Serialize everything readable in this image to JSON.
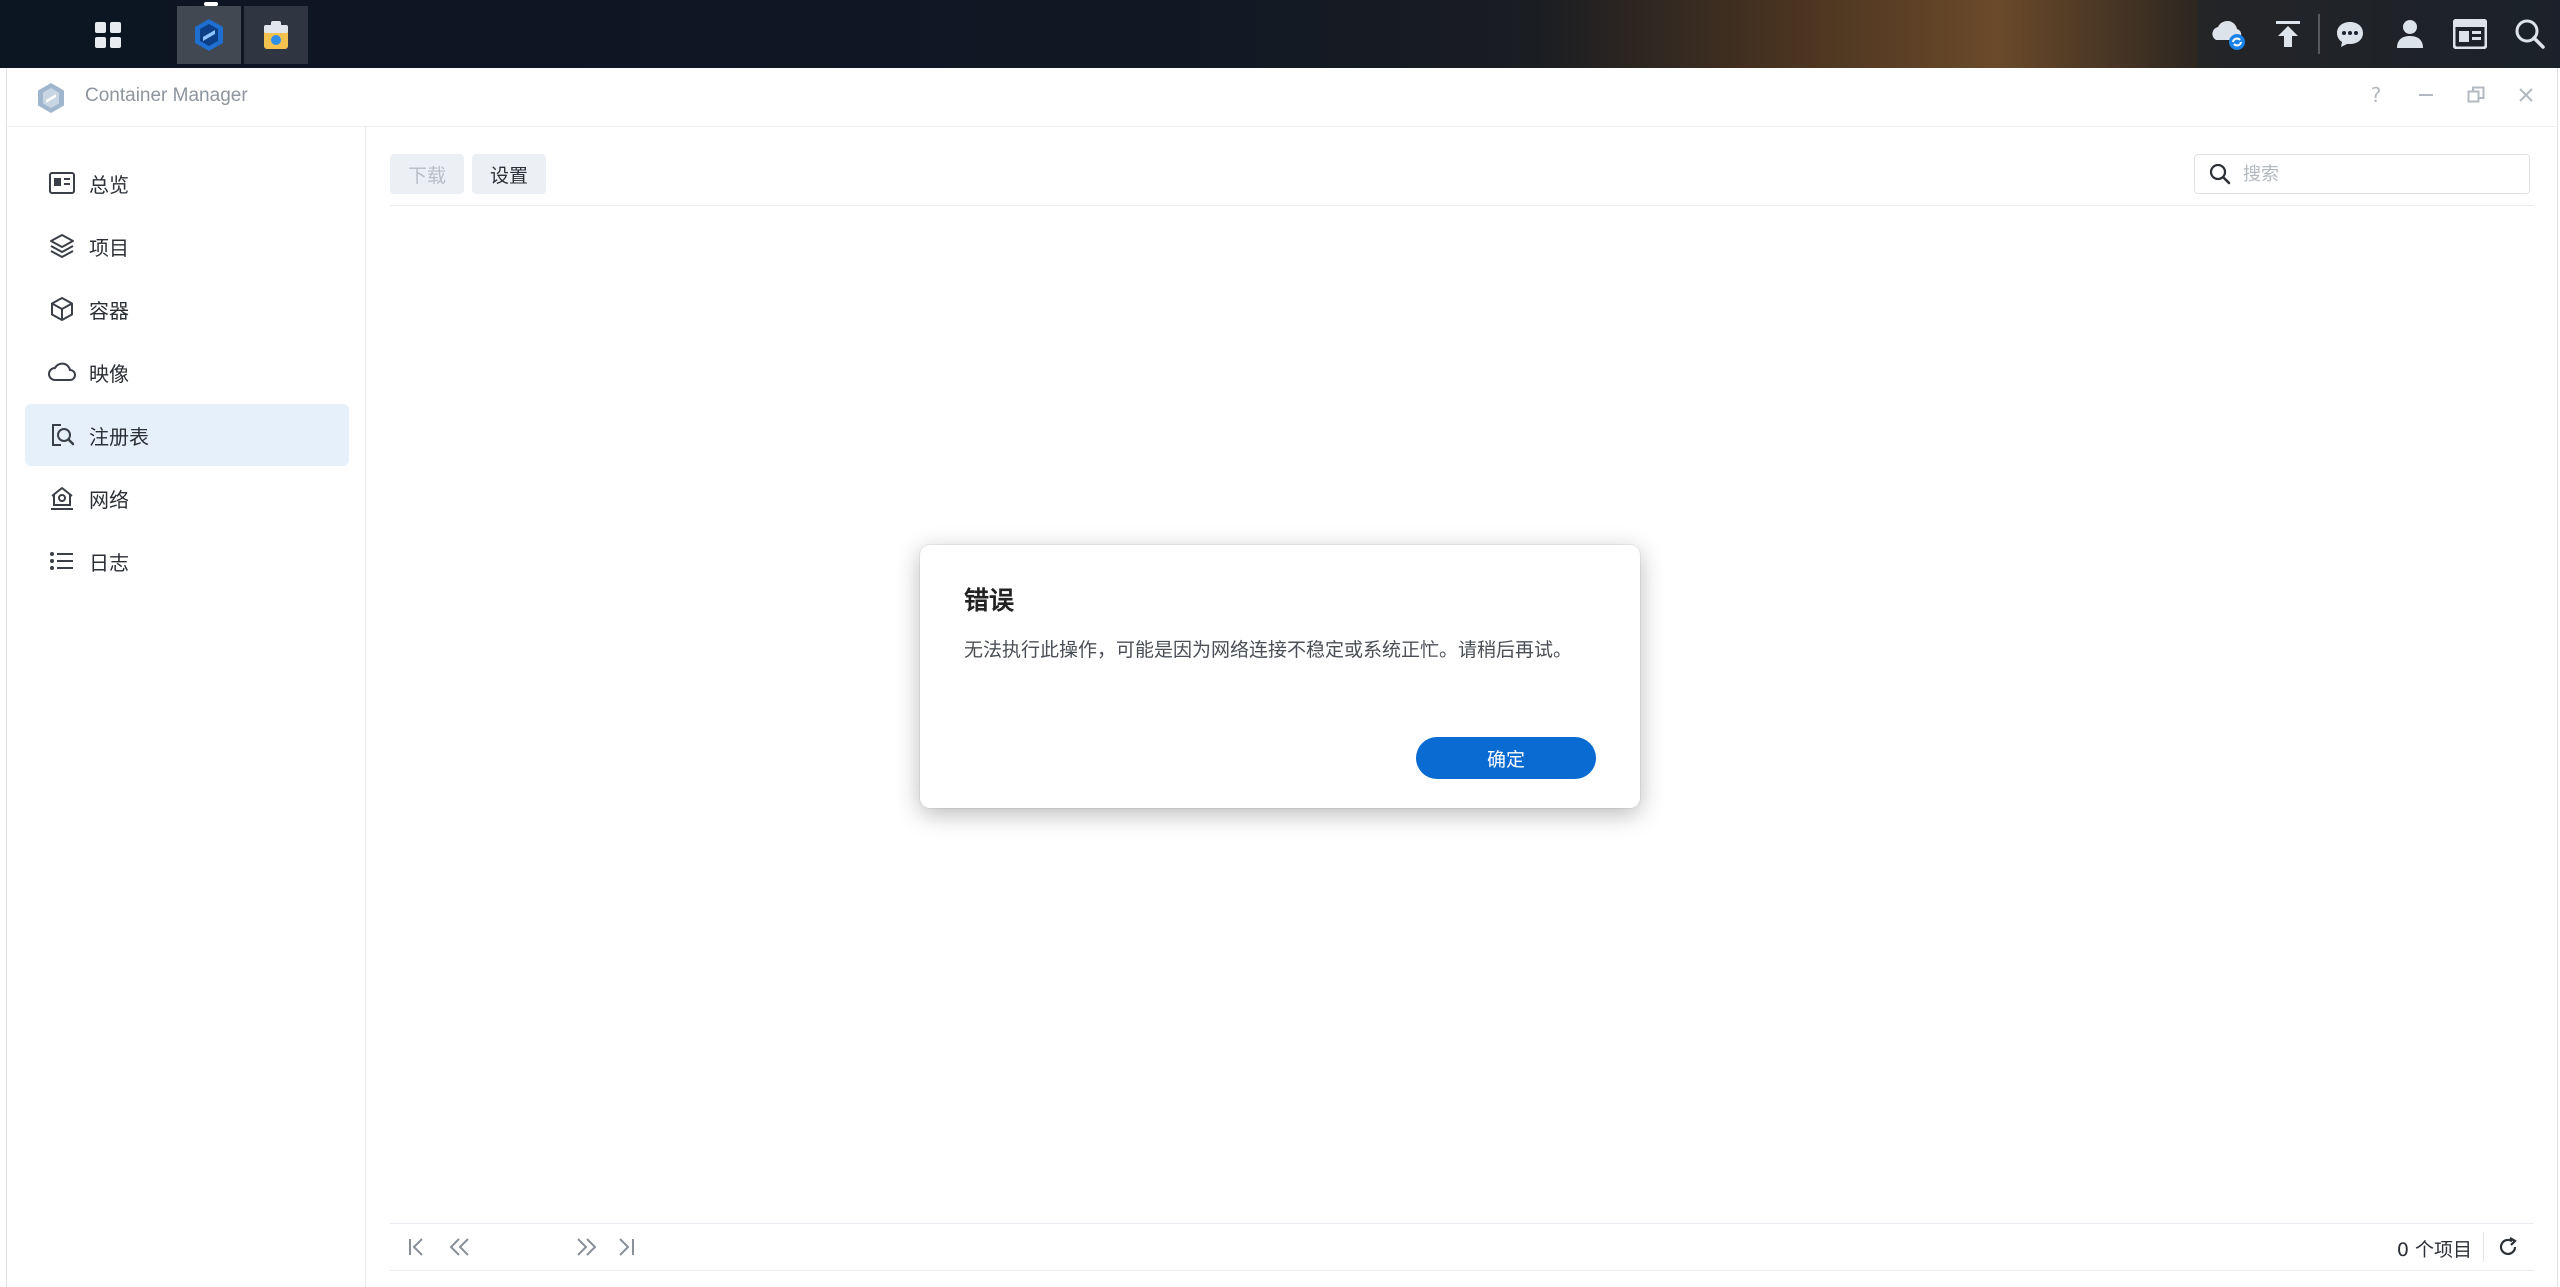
{
  "taskbar": {
    "left_icons": [
      "apps-grid-icon",
      "container-manager-icon",
      "package-center-icon"
    ],
    "right_icons": [
      "cloud-sync-icon",
      "upload-icon",
      "chat-icon",
      "user-icon",
      "widgets-icon",
      "search-icon"
    ]
  },
  "window": {
    "title": "Container Manager",
    "controls": [
      "help-icon",
      "minimize-icon",
      "restore-icon",
      "close-icon"
    ]
  },
  "sidebar": {
    "items": [
      {
        "label": "总览",
        "icon": "overview-icon"
      },
      {
        "label": "项目",
        "icon": "layers-icon"
      },
      {
        "label": "容器",
        "icon": "cube-icon"
      },
      {
        "label": "映像",
        "icon": "cloud-icon"
      },
      {
        "label": "注册表",
        "icon": "registry-search-icon",
        "selected": true
      },
      {
        "label": "网络",
        "icon": "network-house-icon"
      },
      {
        "label": "日志",
        "icon": "list-icon"
      }
    ]
  },
  "toolbar": {
    "download_label": "下载",
    "settings_label": "设置"
  },
  "search": {
    "placeholder": "搜索"
  },
  "pager": {
    "count_label": "0 个项目"
  },
  "dialog": {
    "title": "错误",
    "message": "无法执行此操作，可能是因为网络连接不稳定或系统正忙。请稍后再试。",
    "ok_label": "确定"
  },
  "colors": {
    "accent": "#0a6bd3",
    "selected_bg": "#e6f0fb"
  }
}
